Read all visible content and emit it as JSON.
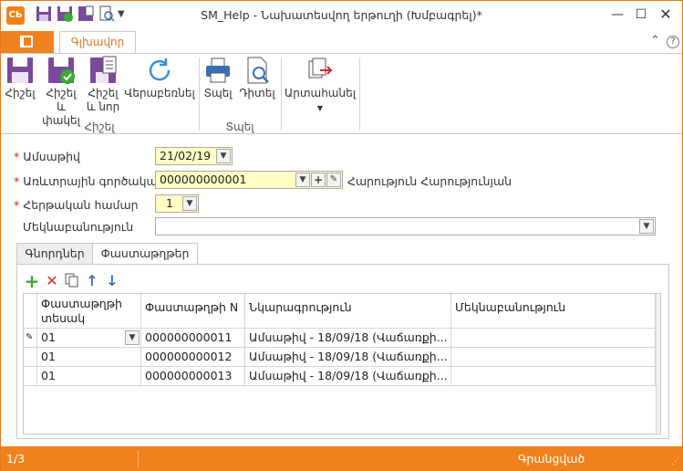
{
  "window": {
    "title": "SM_Help - Նախատեսվող երթուղի (Խմբագրել)*",
    "logo_text": "CЬ"
  },
  "ribbon": {
    "home_tab": "Գլխավոր",
    "buttons": {
      "save": "Հիշել",
      "save_close_1": "Հիշել և",
      "save_close_2": "փակել",
      "save_new_1": "Հիշել",
      "save_new_2": "և նոր",
      "refresh": "Վերաբեռնել",
      "print": "Տպել",
      "preview": "Դիտել",
      "export": "Արտահանել"
    },
    "groups": {
      "save": "Հիշել",
      "print": "Տպել"
    }
  },
  "form": {
    "date_label": "Ամսաթիվ",
    "date_value": "21/02/19",
    "employee_label": "Առևտրային գործակալ",
    "employee_value": "000000000001",
    "employee_name": "Հարություն Հարությունյան",
    "number_label": "Հերթական համար",
    "number_value": "1",
    "comment_label": "Մեկնաբանություն",
    "comment_value": ""
  },
  "tabs": {
    "customers": "Գնորդներ",
    "documents": "Փաստաթղթեր"
  },
  "grid": {
    "headers": [
      "Փաստաթղթի տեսակ",
      "Փաստաթղթի N",
      "Նկարագրություն",
      "Մեկնաբանություն"
    ],
    "header_type_1": "Փաստաթղթի",
    "header_type_2": "տեսակ",
    "rows": [
      {
        "type": "01",
        "number": "000000000011",
        "description": "Ամսաթիվ - 18/09/18 (Վաճառքի...",
        "comment": ""
      },
      {
        "type": "01",
        "number": "000000000012",
        "description": "Ամսաթիվ - 18/09/18 (Վաճառքի...",
        "comment": ""
      },
      {
        "type": "01",
        "number": "000000000013",
        "description": "Ամսաթիվ - 18/09/18 (Վաճառքի...",
        "comment": ""
      }
    ]
  },
  "status": {
    "record": "1/3",
    "state": "Գրանցված"
  },
  "colors": {
    "accent": "#f0821e",
    "required": "#d4252a",
    "highlight": "#ffffc6"
  }
}
